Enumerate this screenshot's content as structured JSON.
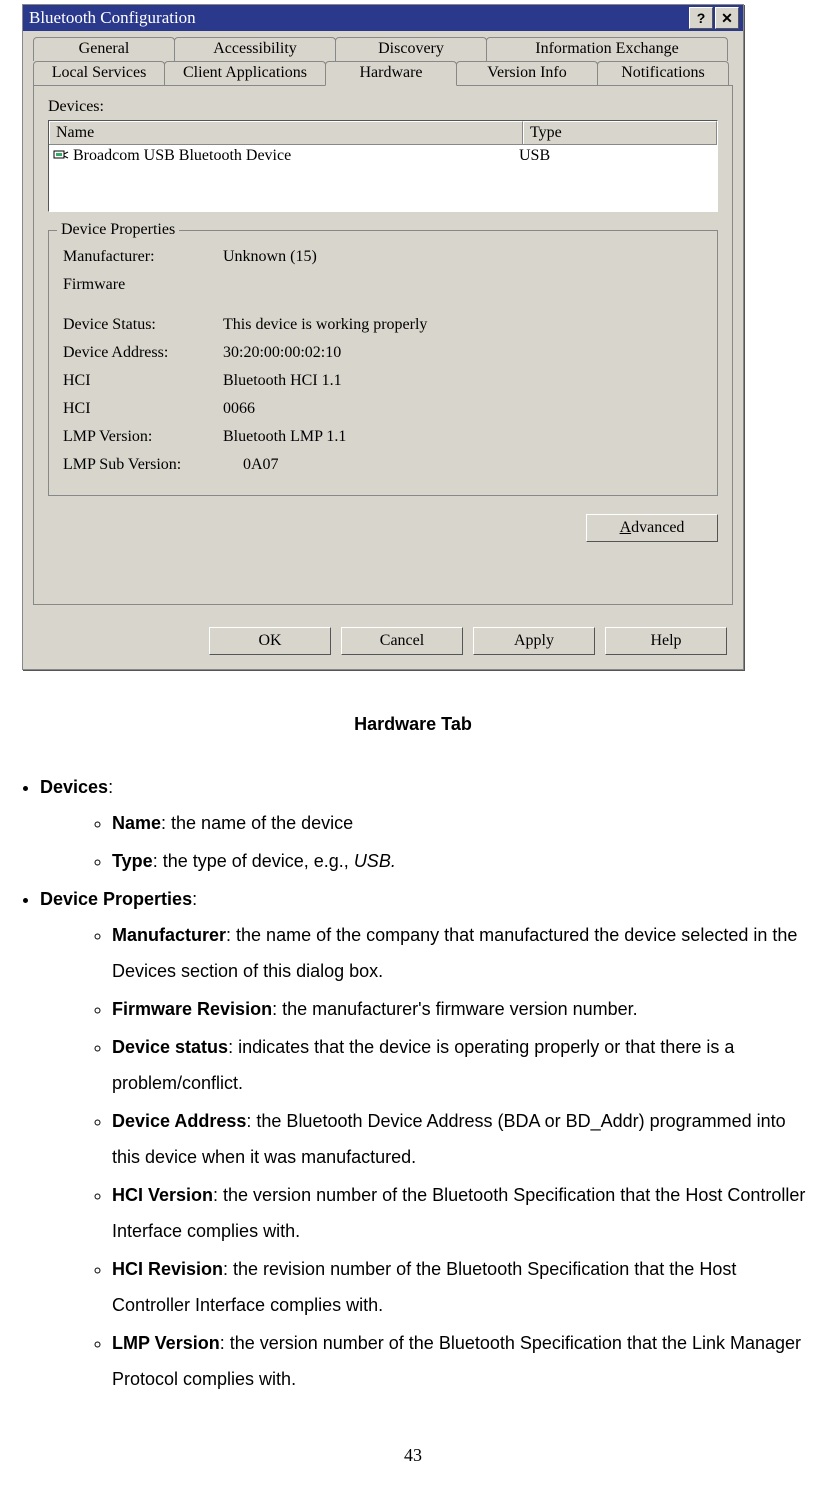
{
  "dialog": {
    "title": "Bluetooth Configuration",
    "help_btn": "?",
    "close_btn": "✕",
    "tabs_row1": [
      "General",
      "Accessibility",
      "Discovery",
      "Information Exchange"
    ],
    "tabs_row2": [
      "Local Services",
      "Client Applications",
      "Hardware",
      "Version Info",
      "Notifications"
    ],
    "devices_label": "Devices:",
    "col_name": "Name",
    "col_type": "Type",
    "row_name": "Broadcom USB Bluetooth Device",
    "row_type": "USB",
    "group_legend": "Device Properties",
    "props": {
      "manufacturer_k": "Manufacturer:",
      "manufacturer_v": "Unknown (15)",
      "firmware_k": "Firmware",
      "status_k": "Device Status:",
      "status_v": "This device is working properly",
      "address_k": "Device Address:",
      "address_v": "30:20:00:00:02:10",
      "hci_k": "HCI",
      "hci_v": "Bluetooth HCI 1.1",
      "hci2_k": "HCI",
      "hci2_v": "0066",
      "lmp_k": "LMP Version:",
      "lmp_v": "Bluetooth LMP 1.1",
      "lmpsub_k": "LMP Sub Version:",
      "lmpsub_v": "0A07"
    },
    "advanced_btn_pre": "A",
    "advanced_btn_post": "dvanced",
    "ok": "OK",
    "cancel": "Cancel",
    "apply": "Apply",
    "help": "Help"
  },
  "caption": "Hardware Tab",
  "doc": {
    "devices_h": "Devices",
    "name_h": "Name",
    "name_t": ": the name of the device",
    "type_h": "Type",
    "type_t": ": the type of device, e.g., ",
    "type_i": "USB.",
    "devprops_h": "Device Properties",
    "manu_h": "Manufacturer",
    "manu_t": ": the name of the company that manufactured the device selected in the Devices section of this dialog box.",
    "fw_h": "Firmware Revision",
    "fw_t": ": the manufacturer's firmware version number.",
    "ds_h": "Device status",
    "ds_t": ": indicates that the device is operating properly or that there is a problem/conflict.",
    "da_h": "Device Address",
    "da_t": ": the Bluetooth Device Address (BDA or BD_Addr) programmed into this device when it was manufactured.",
    "hv_h": "HCI Version",
    "hv_t": ": the version number of the Bluetooth Specification that the Host Controller Interface complies with.",
    "hr_h": "HCI Revision",
    "hr_t": ": the revision number of the Bluetooth Specification that the Host Controller Interface complies with.",
    "lv_h": "LMP Version",
    "lv_t": ": the version number of the Bluetooth Specification that the Link Manager Protocol complies with."
  },
  "page_number": "43"
}
